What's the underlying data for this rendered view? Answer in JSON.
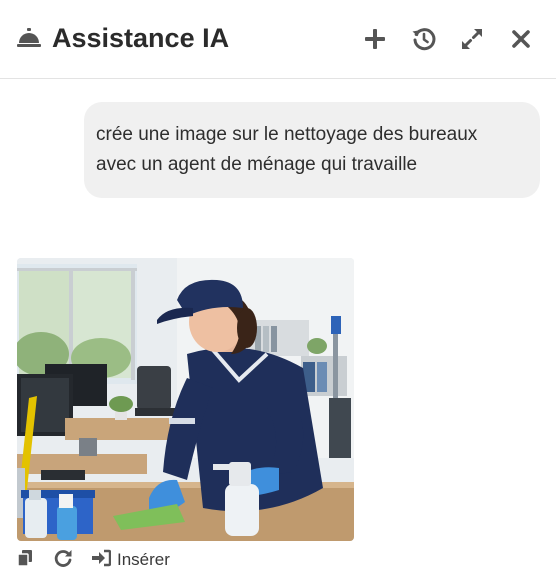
{
  "header": {
    "title": "Assistance IA",
    "icons": {
      "logo": "concierge-bell-icon",
      "new_chat": "plus-icon",
      "history": "history-icon",
      "expand": "expand-icon",
      "close": "close-icon"
    }
  },
  "conversation": {
    "user_message": {
      "lines": [
        "crée une image sur le nettoyage des bureaux",
        "avec un agent de ménage qui travaille"
      ]
    },
    "assistant_message": {
      "image_subject": "cleaning-agent-office-photo",
      "actions": {
        "copy_icon": "copy-icon",
        "retry_icon": "redo-icon",
        "insert_icon": "insert-icon",
        "insert_label": "Insérer"
      }
    }
  },
  "colors": {
    "icon": "#555555",
    "bubble_bg": "#f0f0f0",
    "divider": "#e3e3e3",
    "uniform": "#1f2f5a",
    "glove": "#3f8fdc"
  }
}
